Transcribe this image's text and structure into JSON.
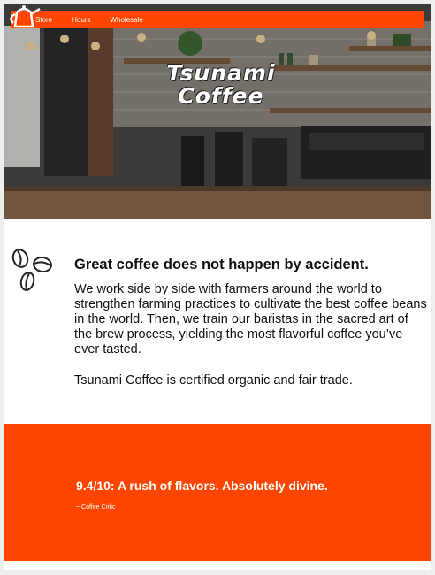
{
  "nav": {
    "items": [
      {
        "label": "Store"
      },
      {
        "label": "Hours"
      },
      {
        "label": "Wholesale"
      }
    ]
  },
  "hero": {
    "brand_line1": "Tsunami",
    "brand_line2": "Coffee",
    "logo_icon": "coffee-kettle-icon"
  },
  "intro": {
    "icon": "coffee-beans-icon",
    "headline": "Great coffee does not happen by accident.",
    "body": "We work side by side with farmers around the world to strengthen farming practices to cultivate the best coffee beans in the world. Then, we train our baristas in the sacred art of the brew process, yielding the most flavorful coffee you’ve ever tasted.",
    "certification": "Tsunami Coffee is certified organic and fair trade."
  },
  "review": {
    "quote": "9.4/10: A rush of flavors. Absolutely divine.",
    "attribution": "~ Coffee Critic"
  },
  "colors": {
    "accent": "#ff4500",
    "text": "#111111",
    "background": "#ffffff"
  }
}
